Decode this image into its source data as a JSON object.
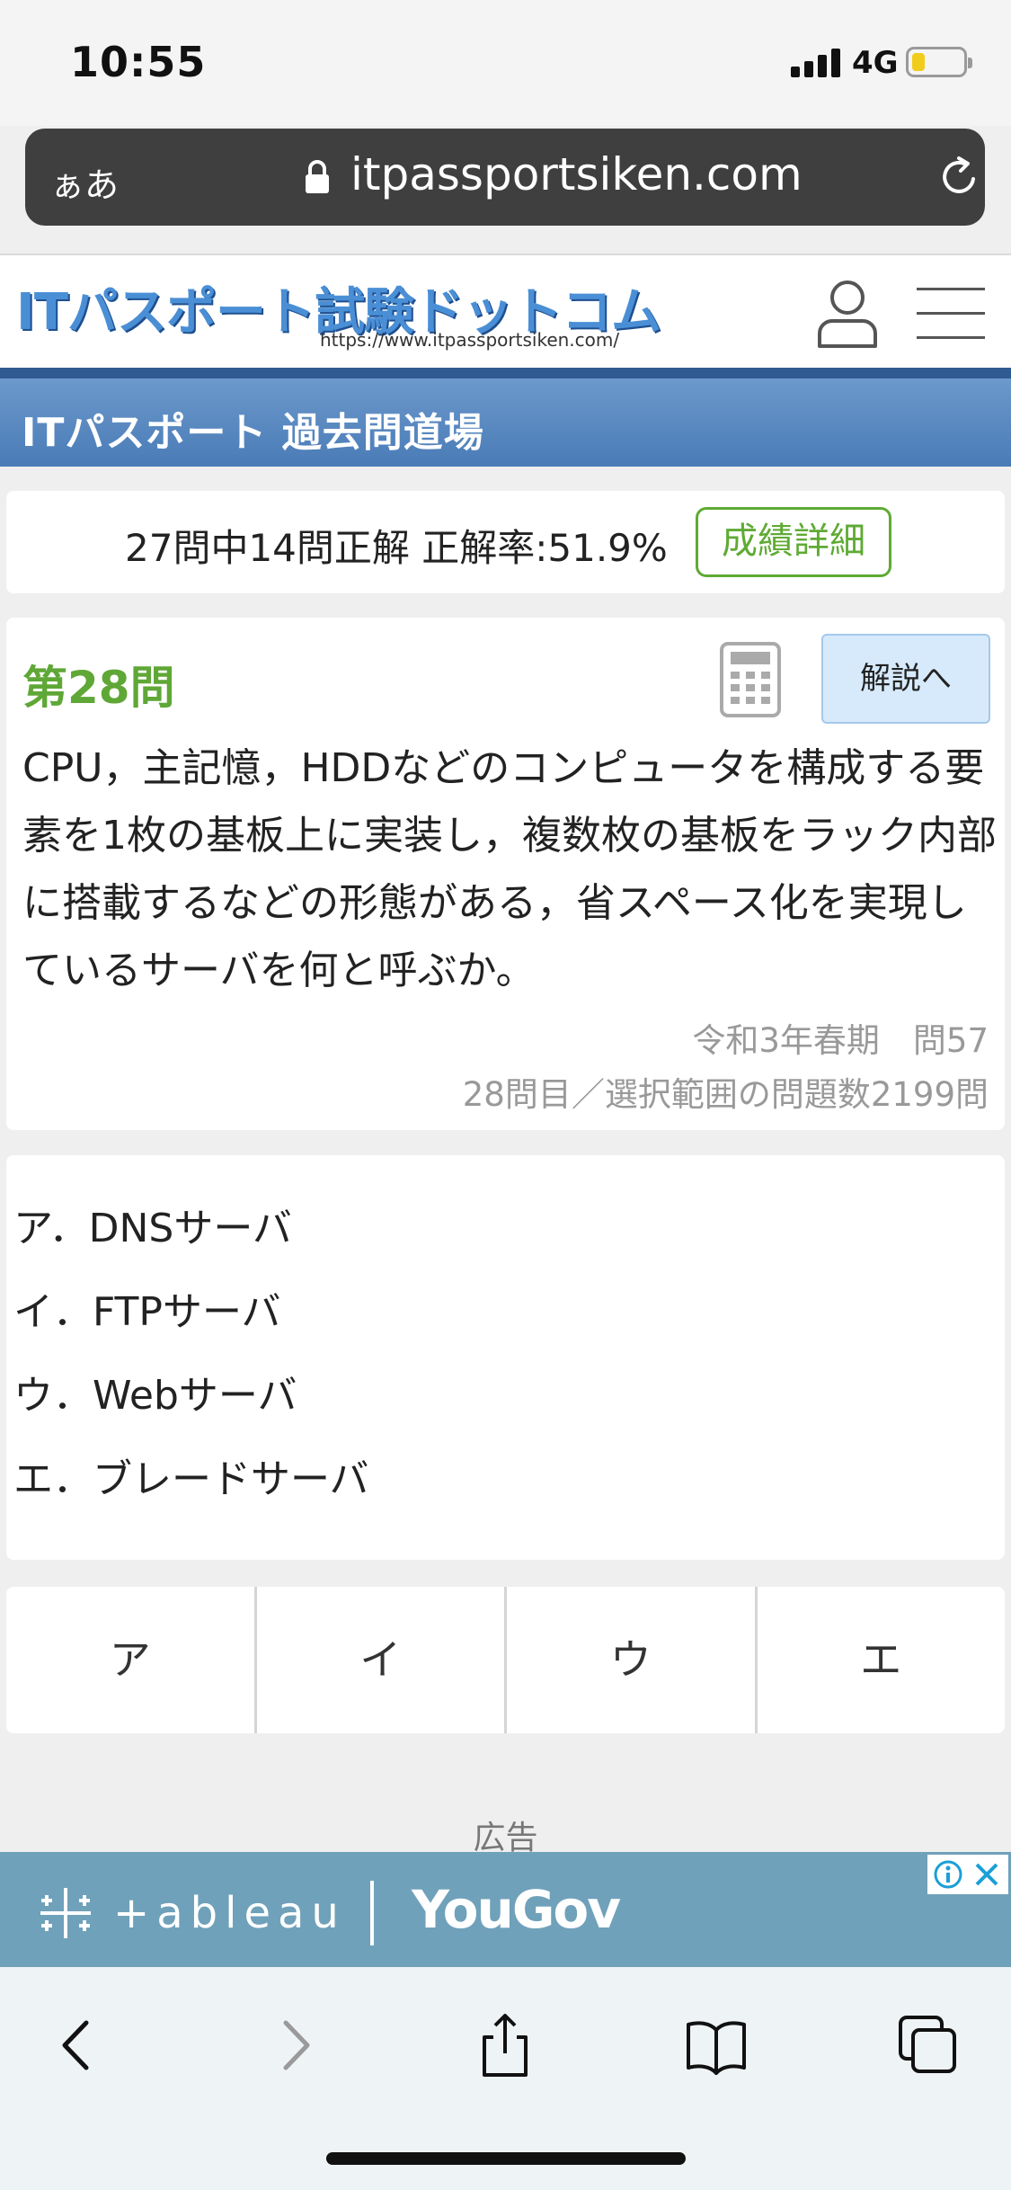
{
  "status_bar": {
    "time": "10:55",
    "network": "4G",
    "battery_level": 0.25
  },
  "browser": {
    "aa_label": "ぁあ",
    "url": "itpassportsiken.com"
  },
  "site": {
    "logo_title": "ITパスポート試験ドットコム",
    "logo_url": "https://www.itpassportsiken.com/",
    "band_title": "ITパスポート 過去問道場"
  },
  "score": {
    "text": "27問中14問正解 正解率:51.9%",
    "detail_label": "成績詳細"
  },
  "question": {
    "number_label": "第28問",
    "explain_label": "解説へ",
    "text": "CPU，主記憶，HDDなどのコンピュータを構成する要素を1枚の基板上に実装し，複数枚の基板をラック内部に搭載するなどの形態がある，省スペース化を実現しているサーバを何と呼ぶか。",
    "source": "令和3年春期　問57",
    "progress": "28問目／選択範囲の問題数2199問"
  },
  "choices": [
    "ア．DNSサーバ",
    "イ．FTPサーバ",
    "ウ．Webサーバ",
    "エ．ブレードサーバ"
  ],
  "answer_buttons": [
    "ア",
    "イ",
    "ウ",
    "エ"
  ],
  "ad": {
    "label": "広告",
    "brand1": "+ableau",
    "brand2": "YouGov"
  },
  "toolbar_icons": [
    "back-icon",
    "forward-icon",
    "share-icon",
    "bookmarks-icon",
    "tabs-icon"
  ]
}
